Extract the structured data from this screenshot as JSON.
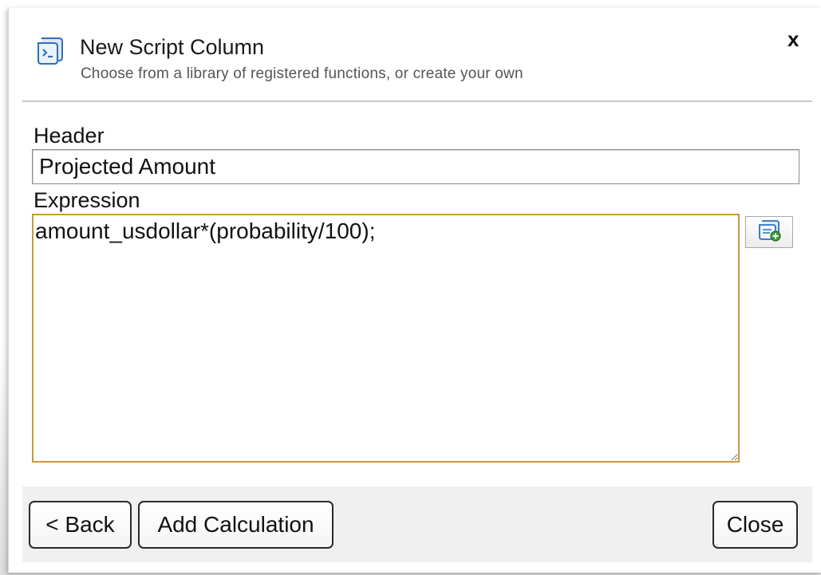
{
  "dialog": {
    "title": "New Script Column",
    "subtitle": "Choose from a library of registered functions, or create your own",
    "close_label": "x",
    "icon": "script-scroll-icon"
  },
  "form": {
    "header_label": "Header",
    "header_value": "Projected Amount",
    "expression_label": "Expression",
    "expression_value": "amount_usdollar*(probability/100);",
    "library_button_icon": "function-library-icon"
  },
  "footer": {
    "back_label": "< Back",
    "add_label": "Add Calculation",
    "close_label": "Close"
  },
  "colors": {
    "focus_border": "#c9993a",
    "icon_blue": "#2f6fb8",
    "icon_green": "#3a9d3a"
  }
}
